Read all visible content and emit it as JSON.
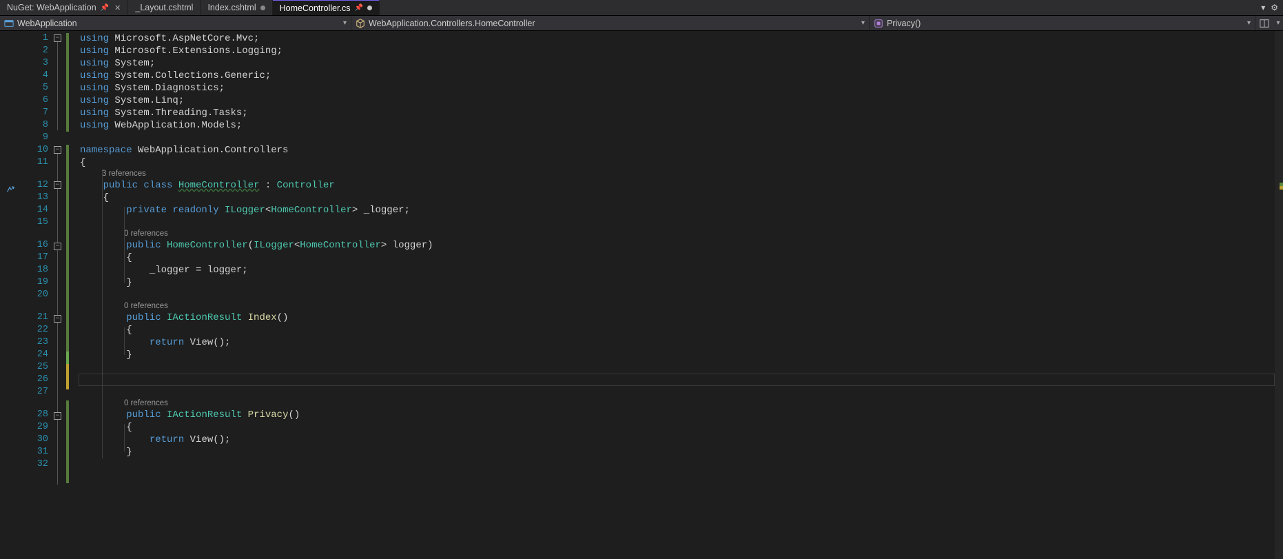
{
  "tabs": [
    {
      "label": "NuGet: WebApplication",
      "pinned": true,
      "close": true,
      "active": false,
      "dirty": false
    },
    {
      "label": "_Layout.cshtml",
      "pinned": false,
      "close": false,
      "active": false,
      "dirty": false
    },
    {
      "label": "Index.cshtml",
      "pinned": false,
      "close": false,
      "active": false,
      "dirty": true
    },
    {
      "label": "HomeController.cs",
      "pinned": true,
      "close": false,
      "active": true,
      "dirty": true
    }
  ],
  "nav": {
    "project": "WebApplication",
    "class": "WebApplication.Controllers.HomeController",
    "member": "Privacy()"
  },
  "codelens": {
    "r3": "3 references",
    "r0a": "0 references",
    "r0b": "0 references",
    "r0c": "0 references"
  },
  "lines": {
    "count": 32,
    "active_line": 26
  },
  "code": {
    "l1": {
      "kw": "using",
      "t": " Microsoft.AspNetCore.Mvc;"
    },
    "l2": {
      "kw": "using",
      "t": " Microsoft.Extensions.Logging;"
    },
    "l3": {
      "kw": "using",
      "t": " System;"
    },
    "l4": {
      "kw": "using",
      "t": " System.Collections.Generic;"
    },
    "l5": {
      "kw": "using",
      "t": " System.Diagnostics;"
    },
    "l6": {
      "kw": "using",
      "t": " System.Linq;"
    },
    "l7": {
      "kw": "using",
      "t": " System.Threading.Tasks;"
    },
    "l8": {
      "kw": "using",
      "t": " WebApplication.Models;"
    },
    "l10": {
      "kw": "namespace",
      "t": " WebApplication.Controllers"
    },
    "l11": "{",
    "l12": {
      "pre": "    ",
      "mods": "public class ",
      "name": "HomeController",
      "sep": " : ",
      "base": "Controller"
    },
    "l13": "    {",
    "l14": {
      "pre": "        ",
      "mods": "private readonly ",
      "ty": "ILogger",
      "lt": "<",
      "gen": "HomeController",
      "gt": "> ",
      "field": "_logger",
      ";": ";"
    },
    "l16": {
      "pre": "        ",
      "mods": "public ",
      "ctor": "HomeController",
      "open": "(",
      "pty": "ILogger",
      "lt": "<",
      "gen": "HomeController",
      "gt": "> ",
      "param": "logger",
      ")": ")"
    },
    "l17": "        {",
    "l18": {
      "pre": "            ",
      "a": "_logger = logger;"
    },
    "l19": "        }",
    "l21": {
      "pre": "        ",
      "mods": "public ",
      "ret": "IActionResult",
      "sp": " ",
      "name": "Index",
      "args": "()"
    },
    "l22": "        {",
    "l23": {
      "pre": "            ",
      "kw": "return",
      "call": " View();"
    },
    "l24": "        }",
    "l28": {
      "pre": "        ",
      "mods": "public ",
      "ret": "IActionResult",
      "sp": " ",
      "name": "Privacy",
      "args": "()"
    },
    "l29": "        {",
    "l30": {
      "pre": "            ",
      "kw": "return",
      "call": " View();"
    },
    "l31": "        }"
  }
}
